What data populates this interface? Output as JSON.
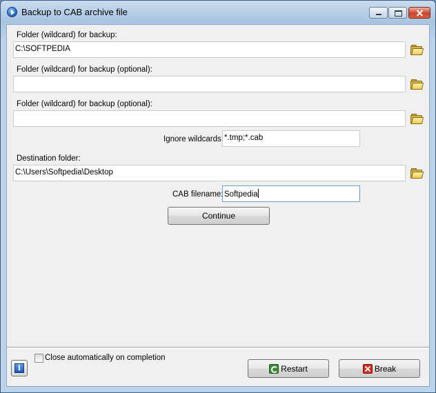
{
  "window": {
    "title": "Backup to CAB archive file"
  },
  "form": {
    "folder1_label": "Folder (wildcard) for backup:",
    "folder1_value": "C:\\SOFTPEDIA",
    "folder2_label": "Folder (wildcard) for backup (optional):",
    "folder2_value": "",
    "folder3_label": "Folder (wildcard) for backup (optional):",
    "folder3_value": "",
    "ignore_label": "Ignore wildcards:",
    "ignore_value": "*.tmp;*.cab",
    "dest_label": "Destination folder:",
    "dest_value": "C:\\Users\\Softpedia\\Desktop",
    "cab_label": "CAB filename:",
    "cab_value": "Softpedia",
    "continue_label": "Continue"
  },
  "footer": {
    "close_auto_label": "Close automatically on completion",
    "close_auto_checked": false,
    "restart_label": "Restart",
    "break_label": "Break"
  },
  "icons": {
    "app": "app-icon",
    "folder": "folder-browse-icon",
    "info": "info-icon",
    "restart": "restart-icon",
    "break": "break-icon"
  }
}
